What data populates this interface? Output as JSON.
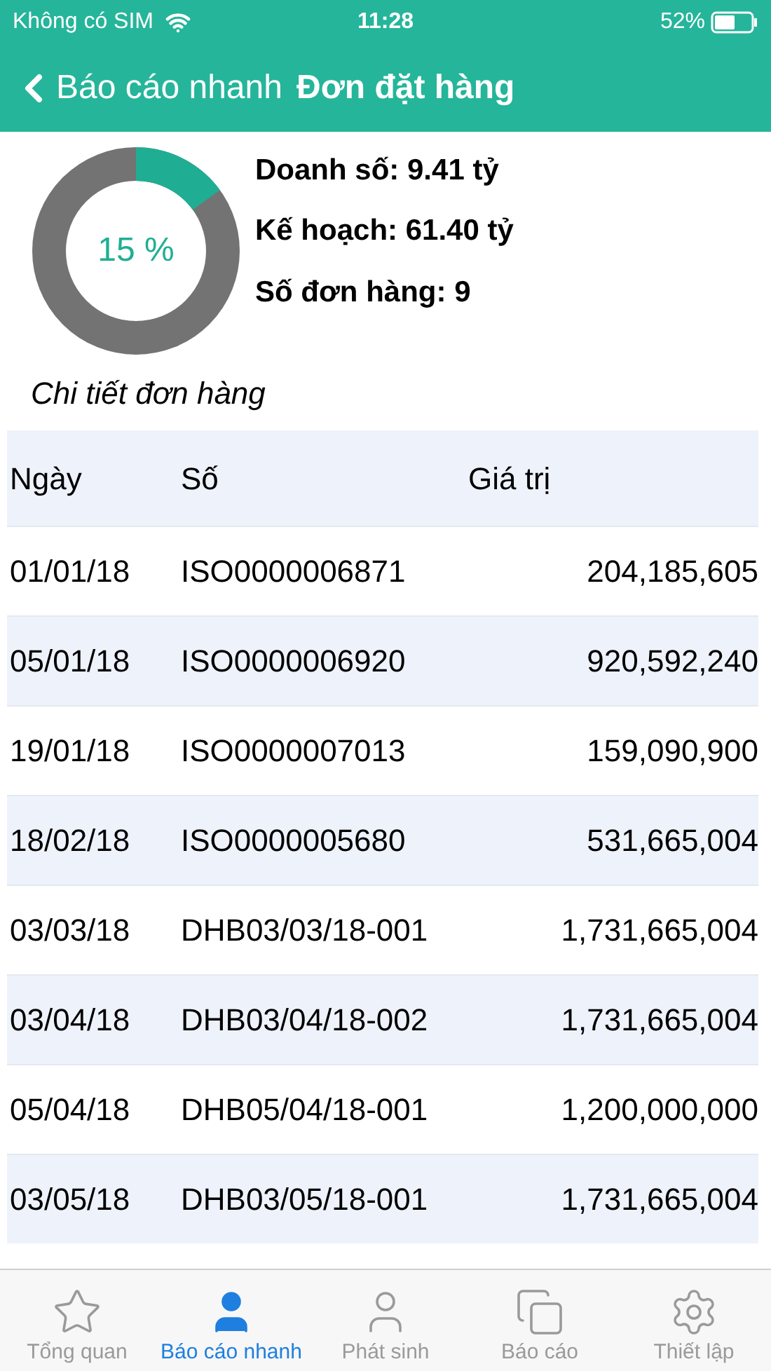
{
  "status_bar": {
    "carrier": "Không có SIM",
    "time": "11:28",
    "battery": "52%"
  },
  "nav": {
    "back": "Báo cáo nhanh",
    "title": "Đơn đặt hàng"
  },
  "summary": {
    "level": 0.15,
    "percent": "15 %",
    "lines": [
      "Doanh số: 9.41 tỷ",
      "Kế hoạch: 61.40 tỷ",
      "Số đơn hàng: 9"
    ]
  },
  "section_title": "Chi tiết đơn hàng",
  "table": {
    "columns": [
      "Ngày",
      "Số",
      "Giá trị"
    ],
    "rows": [
      [
        "01/01/18",
        "ISO0000006871",
        "204,185,605"
      ],
      [
        "05/01/18",
        "ISO0000006920",
        "920,592,240"
      ],
      [
        "19/01/18",
        "ISO0000007013",
        "159,090,900"
      ],
      [
        "18/02/18",
        "ISO0000005680",
        "531,665,004"
      ],
      [
        "03/03/18",
        "DHB03/03/18-001",
        "1,731,665,004"
      ],
      [
        "03/04/18",
        "DHB03/04/18-002",
        "1,731,665,004"
      ],
      [
        "05/04/18",
        "DHB05/04/18-001",
        "1,200,000,000"
      ],
      [
        "03/05/18",
        "DHB03/05/18-001",
        "1,731,665,004"
      ]
    ]
  },
  "tab_bar": [
    {
      "label": "Tổng quan",
      "selected": false
    },
    {
      "label": "Báo cáo nhanh",
      "selected": true
    },
    {
      "label": "Phát sinh",
      "selected": false
    },
    {
      "label": "Báo cáo",
      "selected": false
    },
    {
      "label": "Thiết lập",
      "selected": false
    }
  ]
}
